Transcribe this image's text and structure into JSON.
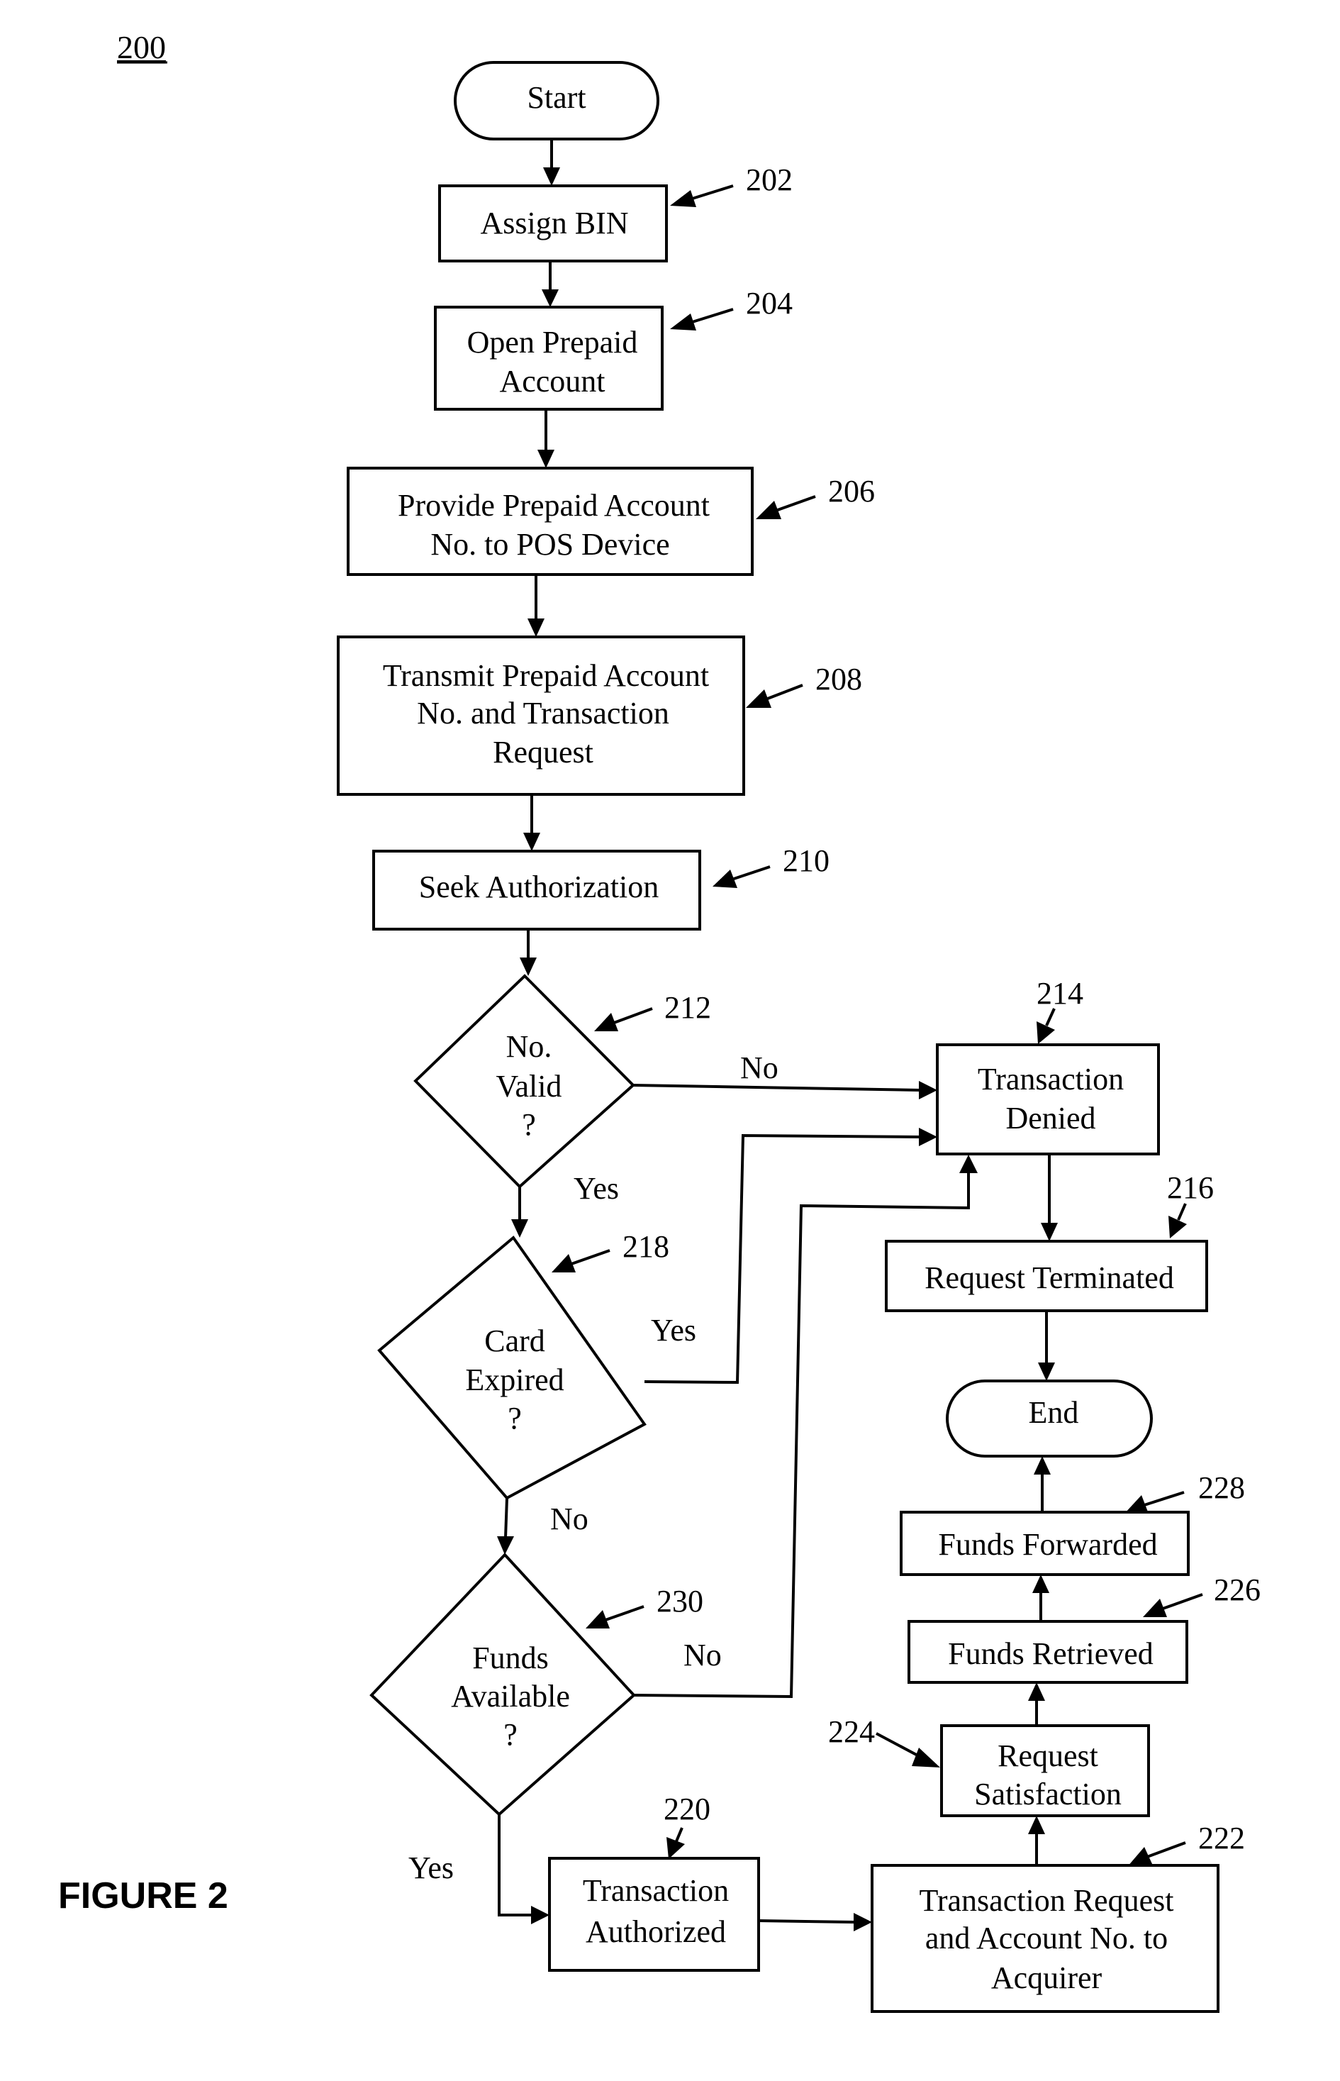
{
  "diagram": {
    "id_label": "200",
    "figure_label": "FIGURE 2",
    "colors": {
      "stroke": "#000000",
      "background": "#ffffff"
    },
    "nodes": {
      "start": {
        "shape": "terminator",
        "lines": [
          "Start"
        ]
      },
      "n202": {
        "shape": "process",
        "ref": "202",
        "lines": [
          "Assign BIN"
        ]
      },
      "n204": {
        "shape": "process",
        "ref": "204",
        "lines": [
          "Open Prepaid",
          "Account"
        ]
      },
      "n206": {
        "shape": "process",
        "ref": "206",
        "lines": [
          "Provide Prepaid Account",
          "No. to POS Device"
        ]
      },
      "n208": {
        "shape": "process",
        "ref": "208",
        "lines": [
          "Transmit Prepaid Account",
          "No. and Transaction",
          "Request"
        ]
      },
      "n210": {
        "shape": "process",
        "ref": "210",
        "lines": [
          "Seek Authorization"
        ]
      },
      "n212": {
        "shape": "decision",
        "ref": "212",
        "lines": [
          "No.",
          "Valid",
          "?"
        ]
      },
      "n214": {
        "shape": "process",
        "ref": "214",
        "lines": [
          "Transaction",
          "Denied"
        ]
      },
      "n216": {
        "shape": "process",
        "ref": "216",
        "lines": [
          "Request Terminated"
        ]
      },
      "end": {
        "shape": "terminator",
        "lines": [
          "End"
        ]
      },
      "n218": {
        "shape": "decision",
        "ref": "218",
        "lines": [
          "Card",
          "Expired",
          "?"
        ]
      },
      "n230": {
        "shape": "decision",
        "ref": "230",
        "lines": [
          "Funds",
          "Available",
          "?"
        ]
      },
      "n220": {
        "shape": "process",
        "ref": "220",
        "lines": [
          "Transaction",
          "Authorized"
        ]
      },
      "n222": {
        "shape": "process",
        "ref": "222",
        "lines": [
          "Transaction Request",
          "and Account No. to",
          "Acquirer"
        ]
      },
      "n224": {
        "shape": "process",
        "ref": "224",
        "lines": [
          "Request",
          "Satisfaction"
        ]
      },
      "n226": {
        "shape": "process",
        "ref": "226",
        "lines": [
          "Funds Retrieved"
        ]
      },
      "n228": {
        "shape": "process",
        "ref": "228",
        "lines": [
          "Funds Forwarded"
        ]
      }
    },
    "edges": [
      {
        "from": "start",
        "to": "n202",
        "label": ""
      },
      {
        "from": "n202",
        "to": "n204",
        "label": ""
      },
      {
        "from": "n204",
        "to": "n206",
        "label": ""
      },
      {
        "from": "n206",
        "to": "n208",
        "label": ""
      },
      {
        "from": "n208",
        "to": "n210",
        "label": ""
      },
      {
        "from": "n210",
        "to": "n212",
        "label": ""
      },
      {
        "from": "n212",
        "to": "n214",
        "label": "No"
      },
      {
        "from": "n212",
        "to": "n218",
        "label": "Yes"
      },
      {
        "from": "n218",
        "to": "n214",
        "label": "Yes"
      },
      {
        "from": "n218",
        "to": "n230",
        "label": "No"
      },
      {
        "from": "n230",
        "to": "n214",
        "label": "No"
      },
      {
        "from": "n230",
        "to": "n220",
        "label": "Yes"
      },
      {
        "from": "n214",
        "to": "n216",
        "label": ""
      },
      {
        "from": "n216",
        "to": "end",
        "label": ""
      },
      {
        "from": "n220",
        "to": "n222",
        "label": ""
      },
      {
        "from": "n222",
        "to": "n224",
        "label": ""
      },
      {
        "from": "n224",
        "to": "n226",
        "label": ""
      },
      {
        "from": "n226",
        "to": "n228",
        "label": ""
      },
      {
        "from": "n228",
        "to": "end",
        "label": ""
      }
    ],
    "branch_labels": {
      "n212_no": "No",
      "n212_yes": "Yes",
      "n218_yes": "Yes",
      "n218_no": "No",
      "n230_no": "No",
      "n230_yes": "Yes"
    }
  }
}
